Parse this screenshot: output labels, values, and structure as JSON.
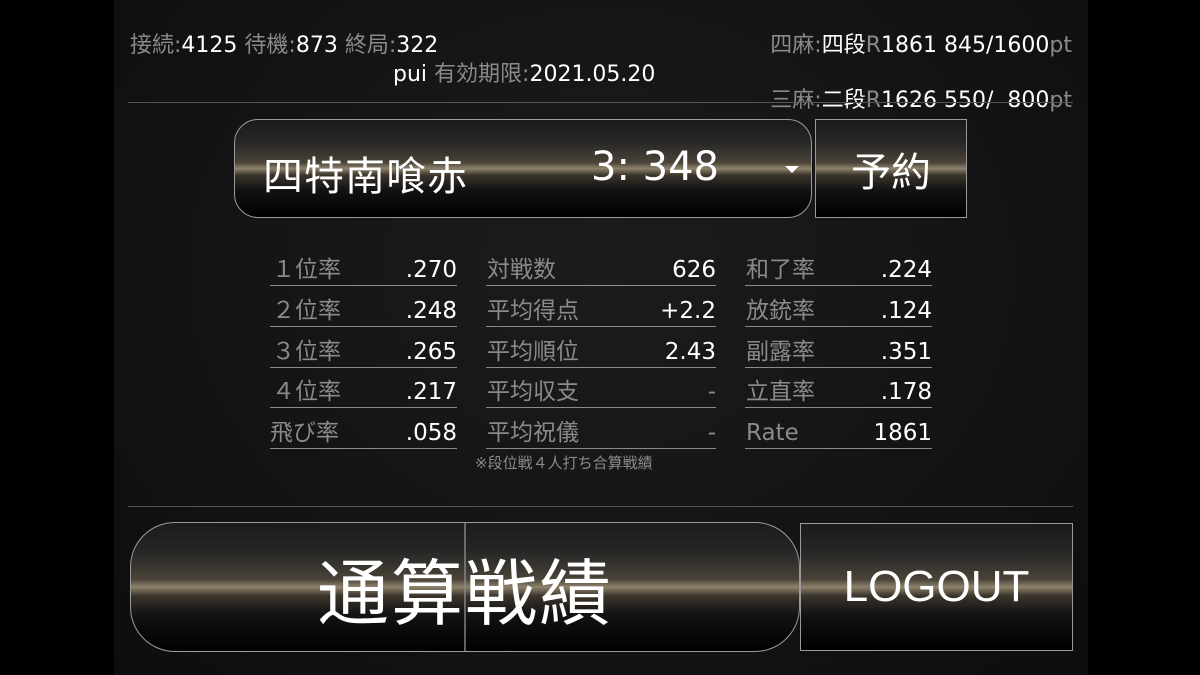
{
  "header": {
    "connect_label": "接続:",
    "connect_value": "4125",
    "wait_label": "待機:",
    "wait_value": "873",
    "end_label": "終局:",
    "end_value": "322",
    "username": "pui",
    "expiry_label": "有効期限:",
    "expiry_value": "2021.05.20",
    "yonma_label": "四麻:",
    "yonma_rank": "四段",
    "yonma_r_label": "R",
    "yonma_rating": "1861",
    "yonma_points": "845/1600",
    "yonma_pt_unit": "pt",
    "sanma_label": "三麻:",
    "sanma_rank": "二段",
    "sanma_r_label": "R",
    "sanma_rating": "1626",
    "sanma_points": "550/  800",
    "sanma_pt_unit": "pt"
  },
  "selector": {
    "room_name": "四特南喰赤",
    "room_value": "3: 348"
  },
  "reserve_button": "予約",
  "stats": {
    "col1": [
      {
        "label": "１位率",
        "value": ".270"
      },
      {
        "label": "２位率",
        "value": ".248"
      },
      {
        "label": "３位率",
        "value": ".265"
      },
      {
        "label": "４位率",
        "value": ".217"
      },
      {
        "label": "飛び率",
        "value": ".058"
      }
    ],
    "col2": [
      {
        "label": "対戦数",
        "value": "626"
      },
      {
        "label": "平均得点",
        "value": "+2.2"
      },
      {
        "label": "平均順位",
        "value": "2.43"
      },
      {
        "label": "平均収支",
        "value": "-"
      },
      {
        "label": "平均祝儀",
        "value": "-"
      }
    ],
    "col3": [
      {
        "label": "和了率",
        "value": ".224"
      },
      {
        "label": "放銃率",
        "value": ".124"
      },
      {
        "label": "副露率",
        "value": ".351"
      },
      {
        "label": "立直率",
        "value": ".178"
      },
      {
        "label": "Rate",
        "value": "1861"
      }
    ],
    "note": "※段位戦４人打ち合算戦績"
  },
  "total_stats_button": "通算戦績",
  "logout_button": "LOGOUT"
}
